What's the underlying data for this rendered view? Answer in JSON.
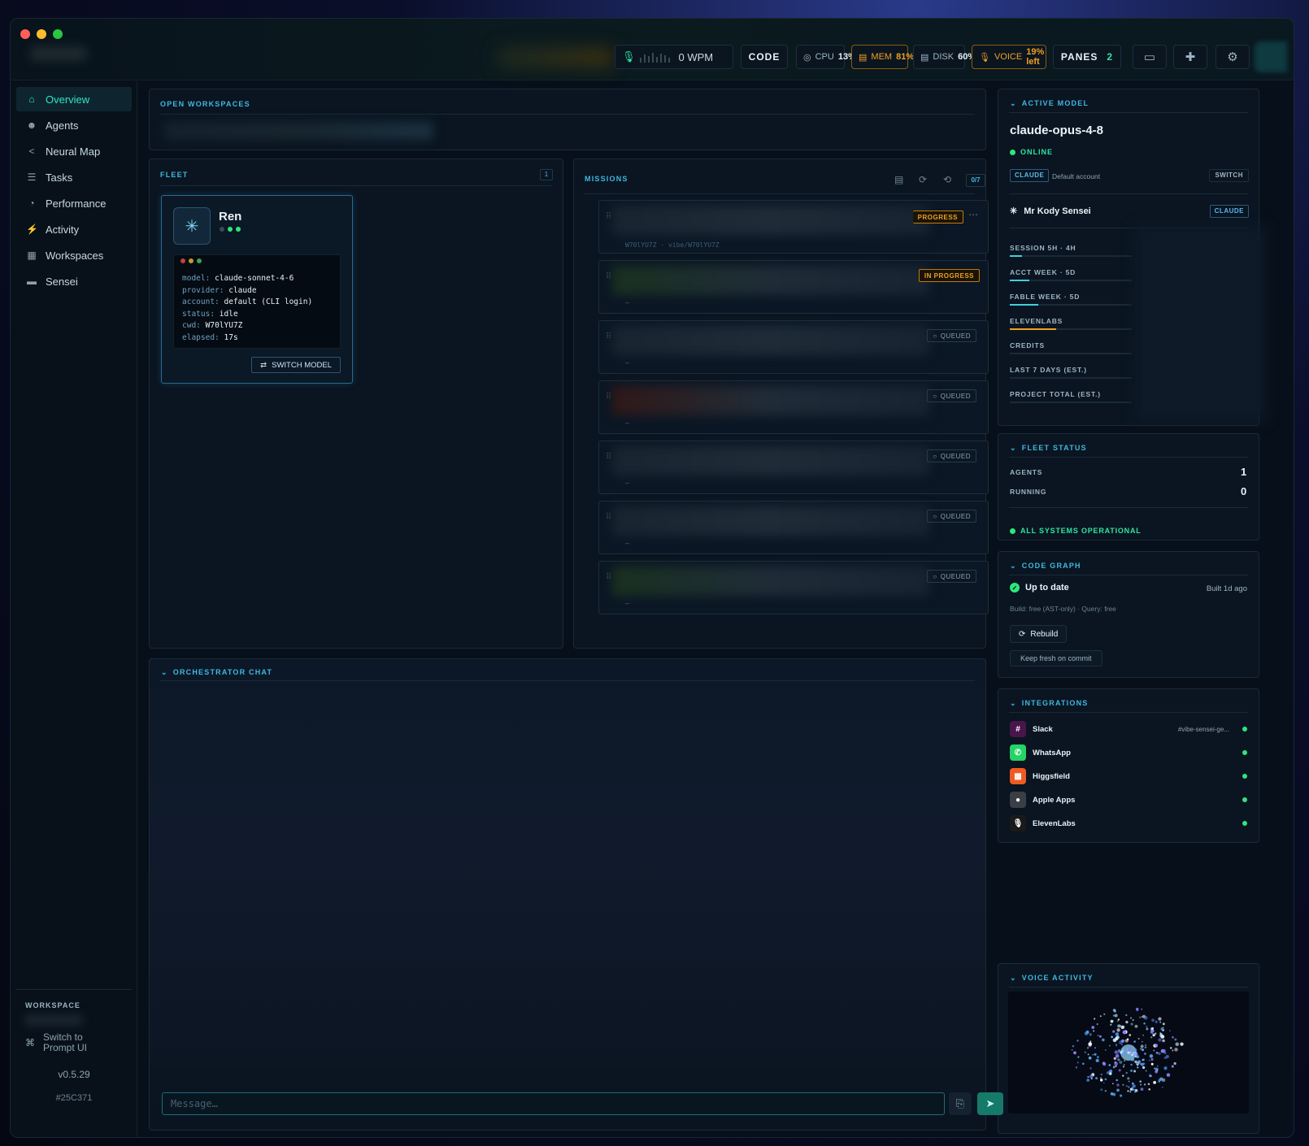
{
  "topbar": {
    "wpm": "0 WPM",
    "mode": "CODE",
    "cpu": {
      "label": "CPU",
      "value": "13%"
    },
    "mem": {
      "label": "MEM",
      "value": "81%"
    },
    "disk": {
      "label": "DISK",
      "value": "60%"
    },
    "voice": {
      "label": "VOICE",
      "value": "19% left"
    },
    "panes": {
      "label": "PANES",
      "value": "2"
    },
    "icons": [
      "monitor-icon",
      "puzzle-icon",
      "gear-icon"
    ]
  },
  "sidebar": {
    "items": [
      {
        "label": "Overview",
        "icon": "home-icon"
      },
      {
        "label": "Agents",
        "icon": "agents-icon"
      },
      {
        "label": "Neural Map",
        "icon": "share-icon"
      },
      {
        "label": "Tasks",
        "icon": "list-icon"
      },
      {
        "label": "Performance",
        "icon": "gauge-icon"
      },
      {
        "label": "Activity",
        "icon": "bolt-icon"
      },
      {
        "label": "Workspaces",
        "icon": "layout-icon"
      },
      {
        "label": "Sensei",
        "icon": "chat-icon"
      }
    ],
    "workspace_label": "WORKSPACE",
    "switch_prompt": "Switch to Prompt UI",
    "version": "v0.5.29",
    "hash": "#25C371"
  },
  "open_workspaces": {
    "title": "OPEN WORKSPACES"
  },
  "fleet": {
    "title": "FLEET",
    "count": "1",
    "agent": {
      "name": "Ren",
      "lines": [
        {
          "k": "model:",
          "v": "claude-sonnet-4-6"
        },
        {
          "k": "provider:",
          "v": "claude"
        },
        {
          "k": "account:",
          "v": "default (CLI login)"
        },
        {
          "k": "status:",
          "v": "idle"
        },
        {
          "k": "cwd:",
          "v": "W70lYU7Z"
        },
        {
          "k": "elapsed:",
          "v": "17s"
        }
      ],
      "switch_label": "SWITCH MODEL"
    }
  },
  "missions": {
    "title": "MISSIONS",
    "count": "0/7",
    "items": [
      {
        "status": "PROGRESS",
        "sub": "W70lYU7Z · vibe/W70lYU7Z"
      },
      {
        "status": "IN PROGRESS",
        "sub": "–"
      },
      {
        "status": "QUEUED",
        "sub": "–"
      },
      {
        "status": "QUEUED",
        "sub": "–"
      },
      {
        "status": "QUEUED",
        "sub": "–"
      },
      {
        "status": "QUEUED",
        "sub": "–"
      },
      {
        "status": "QUEUED",
        "sub": "–"
      }
    ]
  },
  "orchestrator": {
    "title": "ORCHESTRATOR CHAT",
    "placeholder": "Message…"
  },
  "active_model": {
    "title": "ACTIVE MODEL",
    "name": "claude-opus-4-8",
    "status": "ONLINE",
    "provider_chip": "CLAUDE",
    "account": "Default account",
    "switch_label": "SWITCH",
    "sensei": "Mr Kody Sensei",
    "sensei_chip": "CLAUDE",
    "usage": [
      {
        "label": "SESSION 5H · 4H",
        "fill": 0.1,
        "color": "#3fd0e0"
      },
      {
        "label": "ACCT WEEK · 5D",
        "fill": 0.16,
        "color": "#3fd0e0"
      },
      {
        "label": "FABLE WEEK · 5D",
        "fill": 0.23,
        "color": "#3fd0e0"
      },
      {
        "label": "ELEVENLABS",
        "fill": 0.38,
        "color": "#f0a020"
      },
      {
        "label": "CREDITS",
        "fill": 0.0,
        "color": "#3fd0e0"
      },
      {
        "label": "LAST 7 DAYS (EST.)",
        "fill": 0.0,
        "color": "#3fd0e0"
      },
      {
        "label": "PROJECT TOTAL (EST.)",
        "fill": 0.0,
        "color": "#3fd0e0"
      }
    ]
  },
  "fleet_status": {
    "title": "FLEET STATUS",
    "agents_label": "AGENTS",
    "agents": "1",
    "running_label": "RUNNING",
    "running": "0",
    "ok": "ALL SYSTEMS OPERATIONAL"
  },
  "code_graph": {
    "title": "CODE GRAPH",
    "status": "Up to date",
    "built": "Built 1d ago",
    "sub": "Build: free (AST-only) · Query: free",
    "rebuild": "Rebuild",
    "keep_fresh": "Keep fresh on commit"
  },
  "integrations": {
    "title": "INTEGRATIONS",
    "items": [
      {
        "name": "Slack",
        "extra": "#vibe-sensei-ge...",
        "color": "#4a154b",
        "icon": "slack-icon",
        "glyph": "#"
      },
      {
        "name": "WhatsApp",
        "extra": "",
        "color": "#25d366",
        "icon": "whatsapp-icon",
        "glyph": "✆"
      },
      {
        "name": "Higgsfield",
        "extra": "",
        "color": "#f05a20",
        "icon": "higgsfield-icon",
        "glyph": "▦"
      },
      {
        "name": "Apple Apps",
        "extra": "",
        "color": "#3a3f45",
        "icon": "apple-icon",
        "glyph": "●"
      },
      {
        "name": "ElevenLabs",
        "extra": "",
        "color": "#1a1a1a",
        "icon": "mic-icon",
        "glyph": "🎙"
      }
    ]
  },
  "voice_activity": {
    "title": "VOICE ACTIVITY"
  }
}
